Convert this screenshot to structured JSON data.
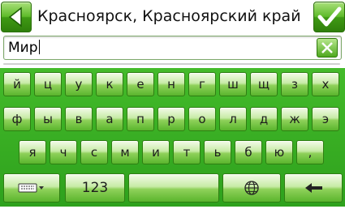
{
  "header": {
    "title": "Красноярск, Красноярский край"
  },
  "search": {
    "value": "Мир"
  },
  "keyboard": {
    "row1": [
      "й",
      "ц",
      "у",
      "к",
      "е",
      "н",
      "г",
      "ш",
      "щ",
      "з",
      "х"
    ],
    "row2": [
      "ф",
      "ы",
      "в",
      "а",
      "п",
      "р",
      "о",
      "л",
      "д",
      "ж",
      "э"
    ],
    "row3": [
      "я",
      "ч",
      "с",
      "м",
      "и",
      "т",
      "ь",
      "б",
      "ю",
      ","
    ],
    "numbers_label": "123"
  },
  "colors": {
    "accent": "#3fa01e",
    "key_top": "#f4fbea",
    "key_bottom": "#5ab52d"
  },
  "icons": [
    "back-arrow-icon",
    "checkmark-icon",
    "clear-x-icon",
    "keyboard-layout-icon",
    "globe-icon",
    "backspace-arrow-icon"
  ]
}
